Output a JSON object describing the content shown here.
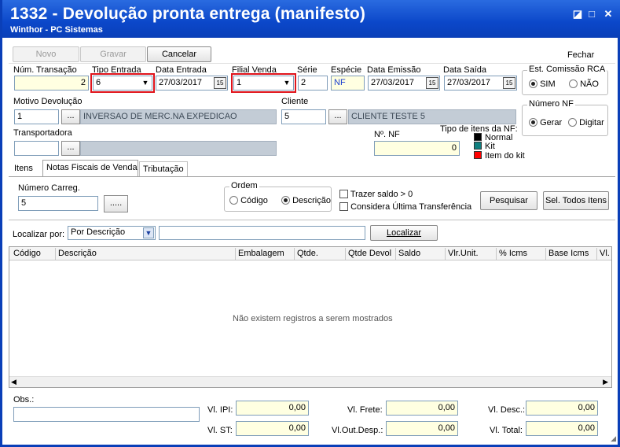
{
  "window": {
    "title": "1332 - Devolução pronta entrega (manifesto)",
    "subtitle": "Winthor - PC Sistemas",
    "btn_min": "◪",
    "btn_max": "□",
    "btn_close": "✕"
  },
  "toolbar": {
    "novo": "Novo",
    "gravar": "Gravar",
    "cancelar": "Cancelar",
    "fechar": "Fechar"
  },
  "form": {
    "num_transacao_label": "Núm. Transação",
    "num_transacao": "2",
    "tipo_entrada_label": "Tipo Entrada",
    "tipo_entrada": "6",
    "data_entrada_label": "Data Entrada",
    "data_entrada": "27/03/2017",
    "filial_venda_label": "Filial Venda",
    "filial_venda": "1",
    "serie_label": "Série",
    "serie": "2",
    "especie_label": "Espécie",
    "especie": "NF",
    "data_emissao_label": "Data Emissão",
    "data_emissao": "27/03/2017",
    "data_saida_label": "Data Saída",
    "data_saida": "27/03/2017",
    "motivo_label": "Motivo Devolução",
    "motivo_cod": "1",
    "motivo_desc": "INVERSAO DE MERC.NA EXPEDICAO",
    "cliente_label": "Cliente",
    "cliente_cod": "5",
    "cliente_desc": "CLIENTE TESTE 5",
    "transportadora_label": "Transportadora",
    "transportadora_cod": "",
    "transportadora_desc": "",
    "num_nf_label": "Nº. NF",
    "num_nf": "0",
    "tipo_itens_label": "Tipo de itens da NF:",
    "legend": [
      {
        "label": "Normal",
        "color": "#000000"
      },
      {
        "label": "Kit",
        "color": "#0f7f7f"
      },
      {
        "label": "Item do kit",
        "color": "#ff0000"
      }
    ],
    "est_comissao": {
      "caption": "Est. Comissão RCA",
      "opt1": "SIM",
      "opt2": "NÃO"
    },
    "numero_nf": {
      "caption": "Número NF",
      "opt1": "Gerar",
      "opt2": "Digitar"
    },
    "ellipsis": "..."
  },
  "tabs": {
    "itens": "Itens",
    "notas": "Notas Fiscais de Venda",
    "tributacao": "Tributação"
  },
  "notas": {
    "num_carreg_label": "Número Carreg.",
    "num_carreg": "5",
    "ellipsis": ".....",
    "ordem": {
      "caption": "Ordem",
      "opt1": "Código",
      "opt2": "Descrição"
    },
    "trazer_saldo": "Trazer saldo > 0",
    "considera": "Considera Última Transferência",
    "pesquisar": "Pesquisar",
    "sel_todos": "Sel. Todos Itens",
    "localizar_por_label": "Localizar por:",
    "localizar_por": "Por Descrição",
    "localizar_btn": "Localizar",
    "columns": [
      "Código",
      "Descrição",
      "Embalagem",
      "Qtde.",
      "Qtde Devol",
      "Saldo",
      "Vlr.Unit.",
      "% Icms",
      "Base Icms",
      "Vl."
    ],
    "empty": "Não existem registros a serem mostrados"
  },
  "footer": {
    "obs_label": "Obs.:",
    "vl_ipi_label": "Vl. IPI:",
    "vl_ipi": "0,00",
    "vl_st_label": "Vl. ST:",
    "vl_st": "0,00",
    "vl_frete_label": "Vl. Frete:",
    "vl_frete": "0,00",
    "vl_outdesp_label": "Vl.Out.Desp.:",
    "vl_outdesp": "0,00",
    "vl_desc_label": "Vl. Desc.:",
    "vl_desc": "0,00",
    "vl_total_label": "Vl. Total:",
    "vl_total": "0,00"
  },
  "colors": {
    "titlebar": "#0a3fb8",
    "highlight": "#e0141b",
    "readonly": "#c3ccd6",
    "required": "#ffffe1"
  }
}
